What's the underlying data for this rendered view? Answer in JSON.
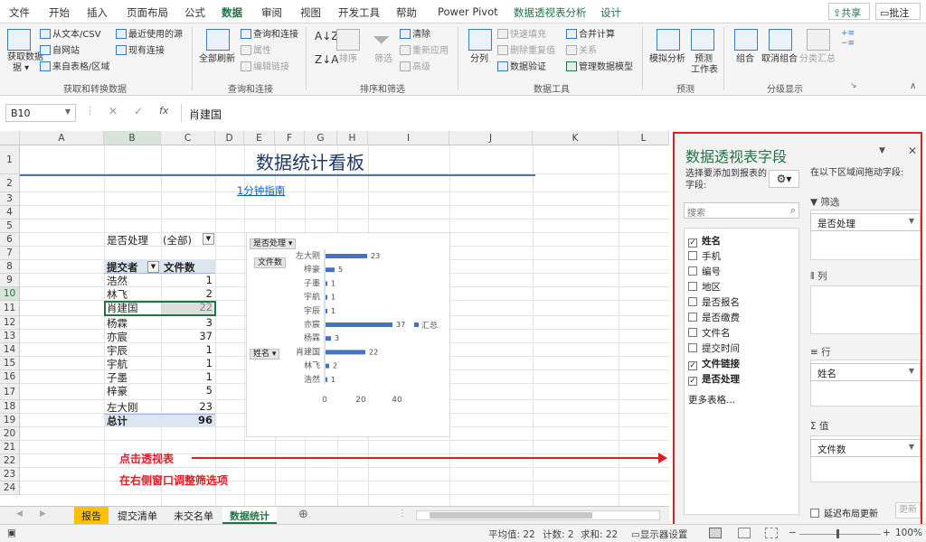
{
  "ribbon_tabs": [
    {
      "label": "文件"
    },
    {
      "label": "开始"
    },
    {
      "label": "插入"
    },
    {
      "label": "页面布局"
    },
    {
      "label": "公式"
    },
    {
      "label": "数据"
    },
    {
      "label": "审阅"
    },
    {
      "label": "视图"
    },
    {
      "label": "开发工具"
    },
    {
      "label": "帮助"
    },
    {
      "label": "Power Pivot"
    },
    {
      "label": "数据透视表分析"
    },
    {
      "label": "设计"
    }
  ],
  "share_label": "共享",
  "comments_label": "批注",
  "ribbon": {
    "get_data": "获取数据",
    "get_data_sub": "据 ▾",
    "from_text": "从文本/CSV",
    "from_web": "自网站",
    "from_table": "来自表格/区域",
    "recent_sources": "最近使用的源",
    "existing_conn": "现有连接",
    "group1": "获取和转换数据",
    "refresh_all": "全部刷新",
    "queries_conn": "查询和连接",
    "properties": "属性",
    "edit_links": "编辑链接",
    "group2": "查询和连接",
    "sort": "排序",
    "filter": "筛选",
    "clear": "清除",
    "reapply": "重新应用",
    "advanced": "高级",
    "group3": "排序和筛选",
    "split": "分列",
    "flash_fill": "快速填充",
    "remove_dup": "删除重复值",
    "validation": "数据验证",
    "consolidate": "合并计算",
    "relations": "关系",
    "data_model": "管理数据模型",
    "group4": "数据工具",
    "whatif": "模拟分析",
    "forecast": "预测",
    "forecast_sheet": "工作表",
    "group5": "预测",
    "group_btn": "组合",
    "ungroup": "取消组合",
    "subtotal": "分类汇总",
    "group6": "分级显示"
  },
  "name_box": "B10",
  "formula_value": "肖建国",
  "columns": [
    "A",
    "B",
    "C",
    "D",
    "E",
    "F",
    "G",
    "H",
    "I",
    "J",
    "K",
    "L"
  ],
  "rows": [
    "1",
    "2",
    "3",
    "4",
    "5",
    "6",
    "7",
    "8",
    "9",
    "10",
    "11",
    "12",
    "13",
    "14",
    "15",
    "16",
    "17",
    "18",
    "19",
    "20",
    "21",
    "22",
    "23",
    "24"
  ],
  "sheet_title": "数据统计看板",
  "guide_link": "1分钟指南",
  "filter_label": "是否处理",
  "filter_value": "(全部)",
  "pivot_header_name": "提交者",
  "pivot_header_count": "文件数",
  "pivot_rows": [
    {
      "name": "浩然",
      "count": 1
    },
    {
      "name": "林飞",
      "count": 2
    },
    {
      "name": "肖建国",
      "count": 22
    },
    {
      "name": "杨霖",
      "count": 3
    },
    {
      "name": "亦宸",
      "count": 37
    },
    {
      "name": "宇辰",
      "count": 1
    },
    {
      "name": "宇航",
      "count": 1
    },
    {
      "name": "子墨",
      "count": 1
    },
    {
      "name": "梓豪",
      "count": 5
    },
    {
      "name": "左大刚",
      "count": 23
    }
  ],
  "pivot_total_label": "总计",
  "pivot_total": 96,
  "chart_data": {
    "type": "bar",
    "orientation": "horizontal",
    "categories": [
      "左大刚",
      "梓豪",
      "子墨",
      "宇航",
      "宇辰",
      "亦宸",
      "杨霖",
      "肖建国",
      "林飞",
      "浩然"
    ],
    "series": [
      {
        "name": "汇总",
        "values": [
          23,
          5,
          1,
          1,
          1,
          37,
          3,
          22,
          2,
          1
        ]
      }
    ],
    "xlim": [
      0,
      40
    ],
    "xticks": [
      "0",
      "20",
      "40"
    ],
    "filter_button": "是否处理",
    "value_button": "文件数",
    "axis_button": "姓名",
    "legend_label": "汇总",
    "bar_color": "#4472c4"
  },
  "annotations": {
    "line1": "点击透视表",
    "line2": "在右侧窗口调整筛选项"
  },
  "pane": {
    "title": "数据透视表字段",
    "choose_label": "选择要添加到报表的字段:",
    "drag_label": "在以下区域间拖动字段:",
    "search_placeholder": "搜索",
    "fields": [
      {
        "label": "姓名",
        "checked": true
      },
      {
        "label": "手机",
        "checked": false
      },
      {
        "label": "编号",
        "checked": false
      },
      {
        "label": "地区",
        "checked": false
      },
      {
        "label": "是否报名",
        "checked": false
      },
      {
        "label": "是否缴费",
        "checked": false
      },
      {
        "label": "文件名",
        "checked": false
      },
      {
        "label": "提交时间",
        "checked": false
      },
      {
        "label": "文件链接",
        "checked": true
      },
      {
        "label": "是否处理",
        "checked": true
      }
    ],
    "more_tables": "更多表格...",
    "filter_zone": "筛选",
    "filter_item": "是否处理",
    "col_zone": "列",
    "row_zone": "行",
    "row_item": "姓名",
    "val_zone": "值",
    "val_item": "文件数",
    "defer_label": "延迟布局更新",
    "update_label": "更新"
  },
  "sheet_tabs": [
    {
      "label": "报告",
      "active": false,
      "color": "#ffc000"
    },
    {
      "label": "提交清单",
      "active": false
    },
    {
      "label": "未交名单",
      "active": false
    },
    {
      "label": "数据统计",
      "active": true
    }
  ],
  "status": {
    "average": "平均值: 22",
    "count": "计数: 2",
    "sum": "求和: 22",
    "display": "显示器设置",
    "zoom": "100%"
  }
}
